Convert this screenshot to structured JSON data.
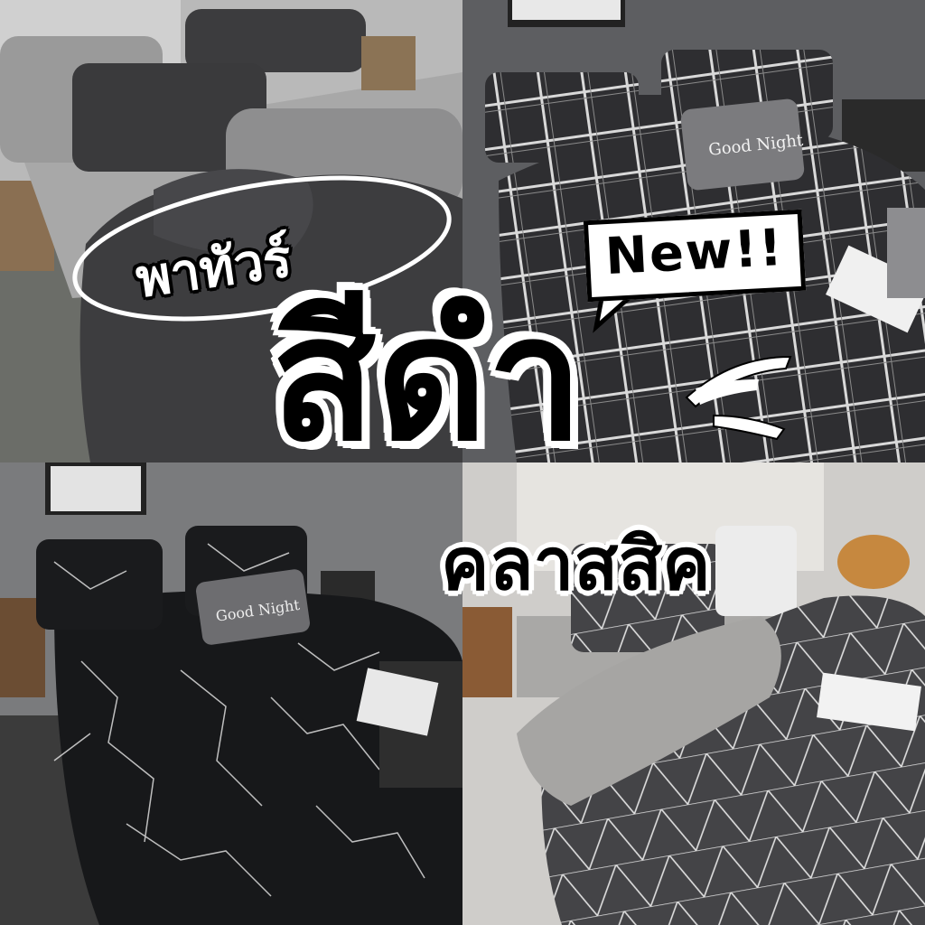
{
  "headline": {
    "tour_label": "พาทัวร์",
    "main_title": "สีดำ",
    "subtitle": "คลาสสิค",
    "badge": "New!!"
  },
  "panels": {
    "top_right_pillow_text": "Good Night",
    "bottom_left_pillow_text": "Good Night"
  },
  "colors": {
    "text_fill": "#000000",
    "text_outline": "#ffffff",
    "dark_bedding": "#2b2b2d",
    "grey_bedding": "#8f8f90"
  }
}
